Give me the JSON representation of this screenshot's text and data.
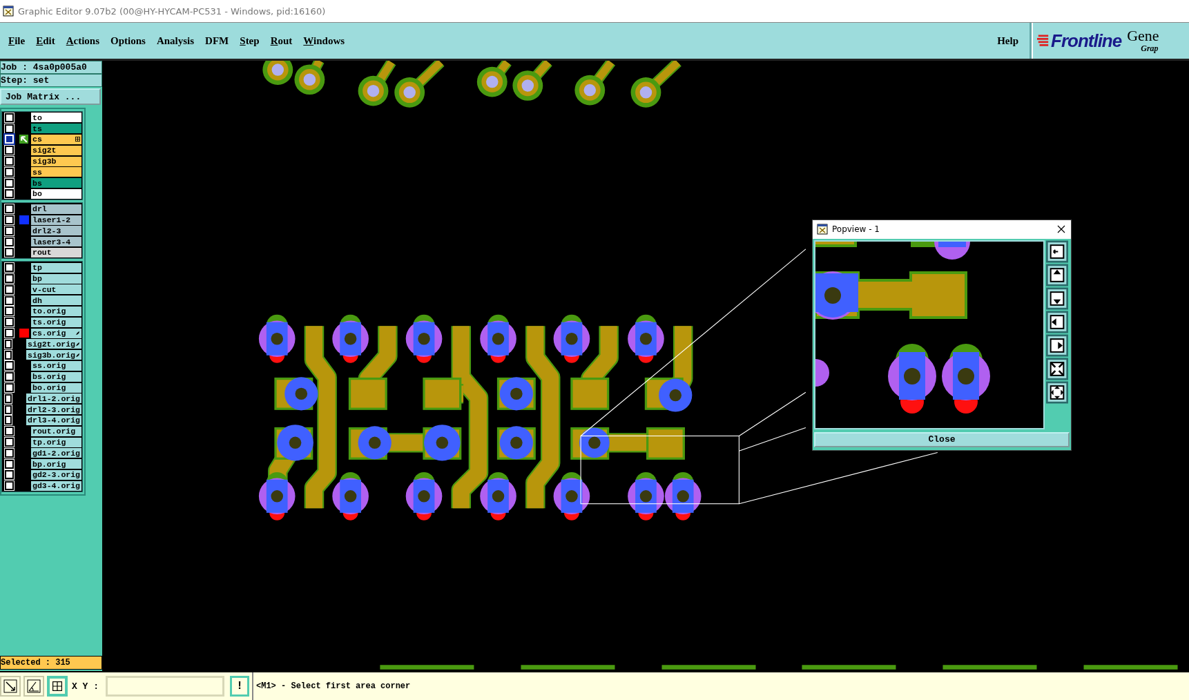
{
  "window": {
    "title": "Graphic Editor 9.07b2 (00@HY-HYCAM-PC531 - Windows, pid:16160)"
  },
  "menu": [
    {
      "label": "File",
      "mnemonic": true
    },
    {
      "label": "Edit",
      "mnemonic": true
    },
    {
      "label": "Actions",
      "mnemonic": true
    },
    {
      "label": "Options",
      "mnemonic": false
    },
    {
      "label": "Analysis",
      "mnemonic": false
    },
    {
      "label": "DFM",
      "mnemonic": false
    },
    {
      "label": "Step",
      "mnemonic": true
    },
    {
      "label": "Rout",
      "mnemonic": true
    },
    {
      "label": "Windows",
      "mnemonic": true
    }
  ],
  "help": "Help",
  "logo": {
    "brand": "Frontline",
    "product": "Gene",
    "subtitle": "Grap"
  },
  "job": "Job : 4sa0p005a0",
  "step": "Step: set",
  "job_matrix_button": "Job Matrix ...",
  "layer_groups": [
    {
      "layers": [
        {
          "name": "to",
          "color": "#ffffff",
          "affected": false
        },
        {
          "name": "ts",
          "color": "#10a080",
          "affected": false
        },
        {
          "name": "cs",
          "color": "#ffc850",
          "affected": true,
          "marker": {
            "kind": "work"
          },
          "kind": "grid"
        },
        {
          "name": "sig2t",
          "color": "#ffc850",
          "affected": false
        },
        {
          "name": "sig3b",
          "color": "#ffc850",
          "affected": false
        },
        {
          "name": "ss",
          "color": "#ffc850",
          "affected": false
        },
        {
          "name": "bs",
          "color": "#10a080",
          "affected": false
        },
        {
          "name": "bo",
          "color": "#ffffff",
          "affected": false
        }
      ]
    },
    {
      "layers": [
        {
          "name": "drl",
          "color": "#a8c4cc",
          "affected": false
        },
        {
          "name": "laser1-2",
          "color": "#a8c4cc",
          "affected": false,
          "marker": {
            "kind": "swatch",
            "color": "#1030ff"
          }
        },
        {
          "name": "drl2-3",
          "color": "#a8c4cc",
          "affected": false
        },
        {
          "name": "laser3-4",
          "color": "#a8c4cc",
          "affected": false
        },
        {
          "name": "rout",
          "color": "#d8d8d8",
          "affected": false
        }
      ]
    },
    {
      "layers": [
        {
          "name": "tp",
          "color": "#a0dcdc",
          "affected": false
        },
        {
          "name": "bp",
          "color": "#a0dcdc",
          "affected": false
        },
        {
          "name": "v-cut",
          "color": "#a0dcdc",
          "affected": false
        },
        {
          "name": "dh",
          "color": "#a0dcdc",
          "affected": false
        },
        {
          "name": "to.orig",
          "color": "#a0dcdc",
          "affected": false
        },
        {
          "name": "ts.orig",
          "color": "#a0dcdc",
          "affected": false
        },
        {
          "name": "cs.orig",
          "color": "#a0dcdc",
          "affected": false,
          "marker": {
            "kind": "swatch",
            "color": "#ff0000"
          },
          "kind": "pin"
        },
        {
          "name": "sig2t.orig",
          "color": "#a0dcdc",
          "affected": false,
          "kind": "pin"
        },
        {
          "name": "sig3b.orig",
          "color": "#a0dcdc",
          "affected": false,
          "kind": "pin"
        },
        {
          "name": "ss.orig",
          "color": "#a0dcdc",
          "affected": false
        },
        {
          "name": "bs.orig",
          "color": "#a0dcdc",
          "affected": false
        },
        {
          "name": "bo.orig",
          "color": "#a0dcdc",
          "affected": false
        },
        {
          "name": "drl1-2.orig",
          "color": "#a0dcdc",
          "affected": false
        },
        {
          "name": "drl2-3.orig",
          "color": "#a0dcdc",
          "affected": false
        },
        {
          "name": "drl3-4.orig",
          "color": "#a0dcdc",
          "affected": false
        },
        {
          "name": "rout.orig",
          "color": "#a0dcdc",
          "affected": false
        },
        {
          "name": "tp.orig",
          "color": "#a0dcdc",
          "affected": false
        },
        {
          "name": "gd1-2.orig",
          "color": "#a0dcdc",
          "affected": false
        },
        {
          "name": "bp.orig",
          "color": "#a0dcdc",
          "affected": false
        },
        {
          "name": "gd2-3.orig",
          "color": "#a0dcdc",
          "affected": false
        },
        {
          "name": "gd3-4.orig",
          "color": "#a0dcdc",
          "affected": false
        }
      ]
    }
  ],
  "selected_count": "Selected : 315",
  "popview": {
    "title": "Popview - 1",
    "close_button": "Close"
  },
  "bottom_bar": {
    "tools": [
      {
        "kind": "diagonal",
        "selected": false
      },
      {
        "kind": "angle",
        "selected": false
      },
      {
        "kind": "grid",
        "selected": true
      }
    ],
    "xy_label": "X Y :",
    "alert_button": "!",
    "message": "<M1> - Select first area corner"
  }
}
